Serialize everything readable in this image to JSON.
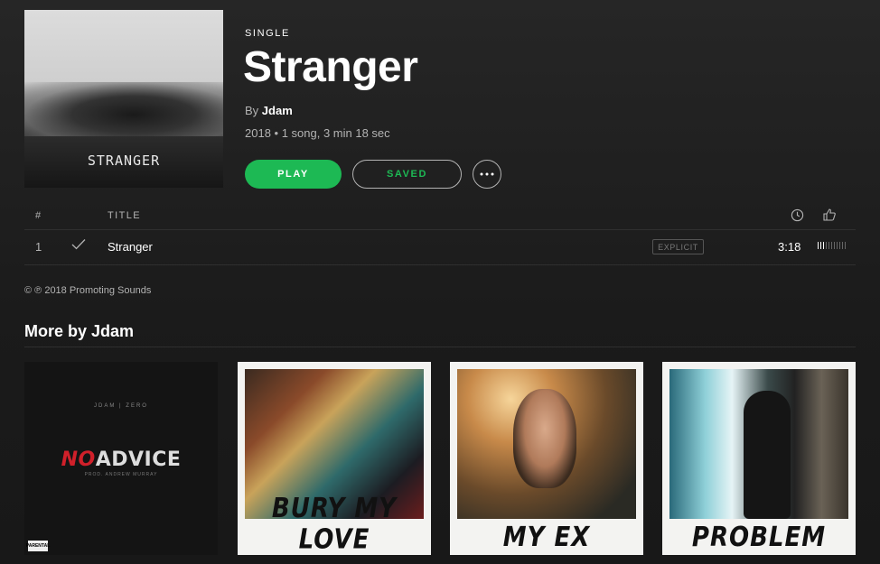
{
  "album": {
    "type_label": "SINGLE",
    "title": "Stranger",
    "by_prefix": "By",
    "artist": "Jdam",
    "meta": "2018 • 1 song, 3 min 18 sec",
    "cover_text": "STRANGER"
  },
  "actions": {
    "play_label": "PLAY",
    "saved_label": "SAVED"
  },
  "tracklist": {
    "columns": {
      "number": "#",
      "title": "TITLE"
    },
    "tracks": [
      {
        "number": "1",
        "title": "Stranger",
        "badge": "EXPLICIT",
        "duration": "3:18",
        "popularity": 0.3
      }
    ]
  },
  "copyright": "© ℗ 2018 Promoting Sounds",
  "more_by": {
    "title": "More by Jdam",
    "albums": [
      {
        "art_top": "JDAM | ZERO",
        "art_no": "NO",
        "art_rest": "ADVICE",
        "art_sub": "PROD. ANDREW MURRAY",
        "advisory": "PARENTAL"
      },
      {
        "caption": "BURY MY LOVE"
      },
      {
        "caption": "MY EX"
      },
      {
        "caption": "PROBLEM"
      }
    ]
  },
  "colors": {
    "accent": "#1db954",
    "background": "#1e1e1e",
    "text_muted": "#b3b3b3"
  }
}
